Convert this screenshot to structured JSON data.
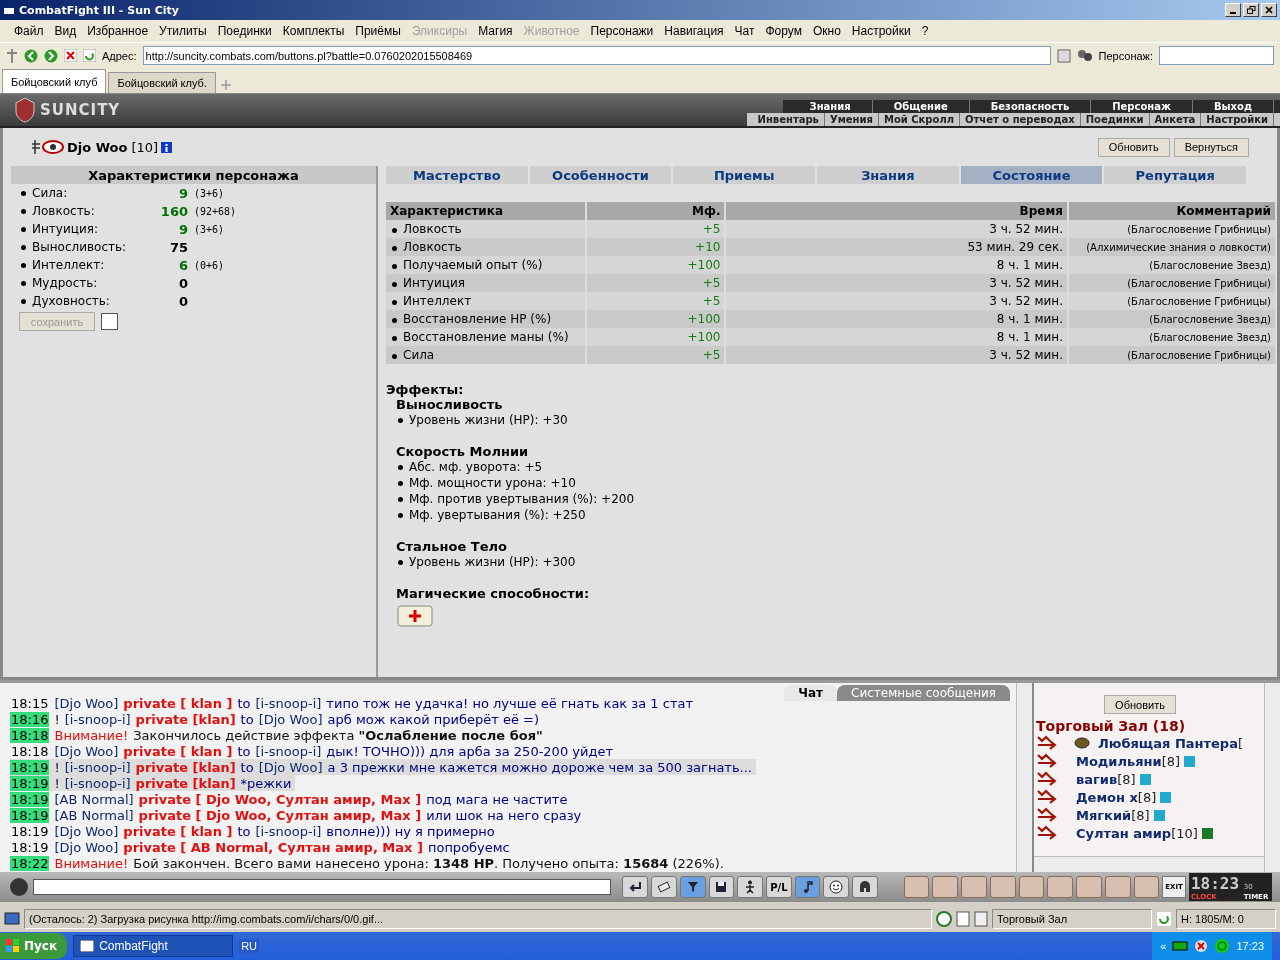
{
  "window": {
    "title": "CombatFight III - Sun City"
  },
  "menu": [
    {
      "label": "Файл",
      "disabled": false
    },
    {
      "label": "Вид",
      "disabled": false
    },
    {
      "label": "Избранное",
      "disabled": false
    },
    {
      "label": "Утилиты",
      "disabled": false
    },
    {
      "label": "Поединки",
      "disabled": false
    },
    {
      "label": "Комплекты",
      "disabled": false
    },
    {
      "label": "Приёмы",
      "disabled": false
    },
    {
      "label": "Эликсиры",
      "disabled": true
    },
    {
      "label": "Магия",
      "disabled": false
    },
    {
      "label": "Животное",
      "disabled": true
    },
    {
      "label": "Персонажи",
      "disabled": false
    },
    {
      "label": "Навигация",
      "disabled": false
    },
    {
      "label": "Чат",
      "disabled": false
    },
    {
      "label": "Форум",
      "disabled": false
    },
    {
      "label": "Окно",
      "disabled": false
    },
    {
      "label": "Настройки",
      "disabled": false
    },
    {
      "label": "?",
      "disabled": false
    }
  ],
  "address_bar": {
    "label": "Адрес:",
    "value": "http://suncity.combats.com/buttons.pl?battle=0.0760202015508469",
    "character_label": "Персонаж:"
  },
  "browser_tabs": [
    {
      "label": "Бойцовский клуб",
      "selected": true
    },
    {
      "label": "Бойцовский клуб.",
      "selected": false
    }
  ],
  "game_header": {
    "logo": "SUNCITY",
    "nav_top": [
      "Знания",
      "Общение",
      "Безопасность",
      "Персонаж",
      "Выход"
    ],
    "nav_bottom": [
      "Инвентарь",
      "Умения",
      "Мой Скролл",
      "Отчет о переводах",
      "Поединки",
      "Анкета",
      "Настройки"
    ]
  },
  "character": {
    "name": "Djo Woo",
    "level": "[10]"
  },
  "buttons": [
    "Обновить",
    "Вернуться"
  ],
  "stats_panel": {
    "title": "Характеристики персонажа",
    "stats": [
      {
        "name": "Сила:",
        "value": "9",
        "detail": "(3+6)",
        "boosted": true
      },
      {
        "name": "Ловкость:",
        "value": "160",
        "detail": "(92+68)",
        "boosted": true
      },
      {
        "name": "Интуиция:",
        "value": "9",
        "detail": "(3+6)",
        "boosted": true
      },
      {
        "name": "Выносливость:",
        "value": "75",
        "boosted": false
      },
      {
        "name": "Интеллект:",
        "value": "6",
        "detail": "(0+6)",
        "boosted": true
      },
      {
        "name": "Мудрость:",
        "value": "0",
        "boosted": false
      },
      {
        "name": "Духовность:",
        "value": "0",
        "boosted": false
      }
    ],
    "save_button": {
      "label": "сохранить",
      "disabled": true
    },
    "checkbox": {
      "checked": false
    }
  },
  "tabs": [
    {
      "label": "Мастерство",
      "selected": false
    },
    {
      "label": "Особенности",
      "selected": false
    },
    {
      "label": "Приемы",
      "selected": false
    },
    {
      "label": "Знания",
      "selected": false
    },
    {
      "label": "Состояние",
      "selected": true
    },
    {
      "label": "Репутация",
      "selected": false
    }
  ],
  "effects_table": {
    "columns": [
      "Характеристика",
      "Мф.",
      "Время",
      "Комментарий"
    ],
    "rows": [
      [
        "Ловкость",
        "+5",
        "3 ч. 52 мин.",
        "(Благословение Грибницы)"
      ],
      [
        "Ловкость",
        "+10",
        "53 мин. 29 сек.",
        "(Алхимические знания о ловкости)"
      ],
      [
        "Получаемый опыт (%)",
        "+100",
        "8 ч. 1 мин.",
        "(Благословение Звезд)"
      ],
      [
        "Интуиция",
        "+5",
        "3 ч. 52 мин.",
        "(Благословение Грибницы)"
      ],
      [
        "Интеллект",
        "+5",
        "3 ч. 52 мин.",
        "(Благословение Грибницы)"
      ],
      [
        "Восстановление HP (%)",
        "+100",
        "8 ч. 1 мин.",
        "(Благословение Звезд)"
      ],
      [
        "Восстановление маны (%)",
        "+100",
        "8 ч. 1 мин.",
        "(Благословение Звезд)"
      ],
      [
        "Сила",
        "+5",
        "3 ч. 52 мин.",
        "(Благословение Грибницы)"
      ]
    ]
  },
  "effects": {
    "heading": "Эффекты:",
    "groups": [
      {
        "title": "Выносливость",
        "items": [
          "Уровень жизни (HP): +30"
        ]
      },
      {
        "title": "Скорость Молнии",
        "items": [
          "Абс. мф. уворота: +5",
          "Мф. мощности урона: +10",
          "Мф. против увертывания (%): +200",
          "Мф. увертывания (%): +250"
        ]
      },
      {
        "title": "Стальное Тело",
        "items": [
          "Уровень жизни (HP): +300"
        ]
      }
    ]
  },
  "magic": {
    "heading": "Магические способности:"
  },
  "chat": {
    "tabs": [
      {
        "label": "Чат",
        "selected": true
      },
      {
        "label": "Системные сообщения",
        "selected": false
      }
    ],
    "messages": [
      {
        "time": "18:15",
        "highlighted": false,
        "shaded": false,
        "parts": [
          {
            "kind": "name",
            "text": "[Djo Woo]"
          },
          {
            "kind": "private",
            "text": "private [ klan ]"
          },
          {
            "kind": "body",
            "text": "to"
          },
          {
            "kind": "name",
            "text": "[i-snoop-i]"
          },
          {
            "kind": "body",
            "text": "типо тож не удачка! но лучше её гнать как за 1 стат"
          }
        ]
      },
      {
        "time": "18:16",
        "highlighted": true,
        "shaded": false,
        "parts": [
          {
            "kind": "plain",
            "text": "!"
          },
          {
            "kind": "name",
            "text": "[i-snoop-i]"
          },
          {
            "kind": "private",
            "text": "private [klan]"
          },
          {
            "kind": "body",
            "text": "to"
          },
          {
            "kind": "name",
            "text": "[Djo Woo]"
          },
          {
            "kind": "body",
            "text": "арб мож какой приберёт её =)"
          }
        ]
      },
      {
        "time": "18:18",
        "highlighted": true,
        "shaded": false,
        "parts": [
          {
            "kind": "alert",
            "text": "Внимание!"
          },
          {
            "kind": "plain",
            "text": "Закончилось действие эффекта **\"Ослабление после боя\"**"
          }
        ]
      },
      {
        "time": "18:18",
        "highlighted": false,
        "shaded": false,
        "parts": [
          {
            "kind": "name",
            "text": "[Djo Woo]"
          },
          {
            "kind": "private",
            "text": "private [ klan ]"
          },
          {
            "kind": "body",
            "text": "to"
          },
          {
            "kind": "name",
            "text": "[i-snoop-i]"
          },
          {
            "kind": "body",
            "text": "дык! ТОЧНО))) для арба за 250-200 уйдет"
          }
        ]
      },
      {
        "time": "18:19",
        "highlighted": true,
        "shaded": true,
        "parts": [
          {
            "kind": "plain",
            "text": "!"
          },
          {
            "kind": "name",
            "text": "[i-snoop-i]"
          },
          {
            "kind": "private",
            "text": "private [klan]"
          },
          {
            "kind": "body",
            "text": "to"
          },
          {
            "kind": "name",
            "text": "[Djo Woo]"
          },
          {
            "kind": "body",
            "text": "а 3 прежки мне кажется можно дороже чем за 500 загнать..."
          }
        ]
      },
      {
        "time": "18:19",
        "highlighted": true,
        "shaded": true,
        "parts": [
          {
            "kind": "plain",
            "text": "!"
          },
          {
            "kind": "name",
            "text": "[i-snoop-i]"
          },
          {
            "kind": "private",
            "text": "private [klan]"
          },
          {
            "kind": "body",
            "text": "*режки"
          }
        ]
      },
      {
        "time": "18:19",
        "highlighted": true,
        "shaded": false,
        "parts": [
          {
            "kind": "name",
            "text": "[AB Normal]"
          },
          {
            "kind": "private",
            "text": "private [ Djo Woo, Султан амир, Max ]"
          },
          {
            "kind": "body",
            "text": "под мага не частите"
          }
        ]
      },
      {
        "time": "18:19",
        "highlighted": true,
        "shaded": false,
        "parts": [
          {
            "kind": "name",
            "text": "[AB Normal]"
          },
          {
            "kind": "private",
            "text": "private [ Djo Woo, Султан амир, Max ]"
          },
          {
            "kind": "body",
            "text": "или шок на него сразу"
          }
        ]
      },
      {
        "time": "18:19",
        "highlighted": false,
        "shaded": false,
        "parts": [
          {
            "kind": "name",
            "text": "[Djo Woo]"
          },
          {
            "kind": "private",
            "text": "private [ klan ]"
          },
          {
            "kind": "body",
            "text": "to"
          },
          {
            "kind": "name",
            "text": "[i-snoop-i]"
          },
          {
            "kind": "body",
            "text": "вполне))) ну я примерно"
          }
        ]
      },
      {
        "time": "18:19",
        "highlighted": false,
        "shaded": false,
        "parts": [
          {
            "kind": "name",
            "text": "[Djo Woo]"
          },
          {
            "kind": "private",
            "text": "private [ AB Normal, Султан амир, Max ]"
          },
          {
            "kind": "body",
            "text": "попробуемс"
          }
        ]
      },
      {
        "time": "18:22",
        "highlighted": true,
        "shaded": false,
        "parts": [
          {
            "kind": "alert",
            "text": "Внимание!"
          },
          {
            "kind": "plain",
            "text": "Бой закончен. Всего вами нанесено урона: **1348 HP**. Получено опыта: **15684** (226%)."
          }
        ]
      }
    ]
  },
  "user_list": {
    "refresh": "Обновить",
    "room": "Торговый Зал (18)",
    "users": [
      {
        "name": "Любящая Пантера",
        "level": "[",
        "kind": "clan"
      },
      {
        "name": "Модильяни",
        "level": "[8]",
        "color": "#22aacc",
        "kind": "info"
      },
      {
        "name": "вагив",
        "level": "[8]",
        "color": "#22aacc",
        "kind": "info"
      },
      {
        "name": "Демон х",
        "level": "[8]",
        "color": "#22aacc",
        "kind": "info"
      },
      {
        "name": "Мягкий",
        "level": "[8]",
        "color": "#22aacc",
        "kind": "info"
      },
      {
        "name": "Султан амир",
        "level": "[10]",
        "color": "#1a7a2a",
        "kind": "info"
      }
    ]
  },
  "toolbar": {
    "buttons": [
      {
        "kind": "enter",
        "selected": false
      },
      {
        "kind": "eraser",
        "selected": false
      },
      {
        "kind": "filter",
        "selected": true
      },
      {
        "kind": "floppy",
        "selected": false
      },
      {
        "kind": "figure",
        "selected": false
      },
      {
        "kind": "text",
        "label": "P/L",
        "selected": false
      },
      {
        "kind": "note",
        "selected": true
      },
      {
        "kind": "smiley",
        "selected": false
      },
      {
        "kind": "helmet",
        "selected": false
      }
    ],
    "exit_label": "EXIT",
    "clock": {
      "time": "18:23",
      "seconds": "30",
      "labels": [
        "CLOCK",
        "TIMER"
      ]
    }
  },
  "status_bar": {
    "text": "(Осталось: 2) Загрузка рисунка http://img.combats.com/i/chars/0/0.gif...",
    "zone": "Торговый Зал",
    "stats": "H: 1805/M: 0"
  },
  "taskbar": {
    "start": "Пуск",
    "task": "CombatFight",
    "language": "RU",
    "chevron": "«",
    "time": "17:23"
  }
}
